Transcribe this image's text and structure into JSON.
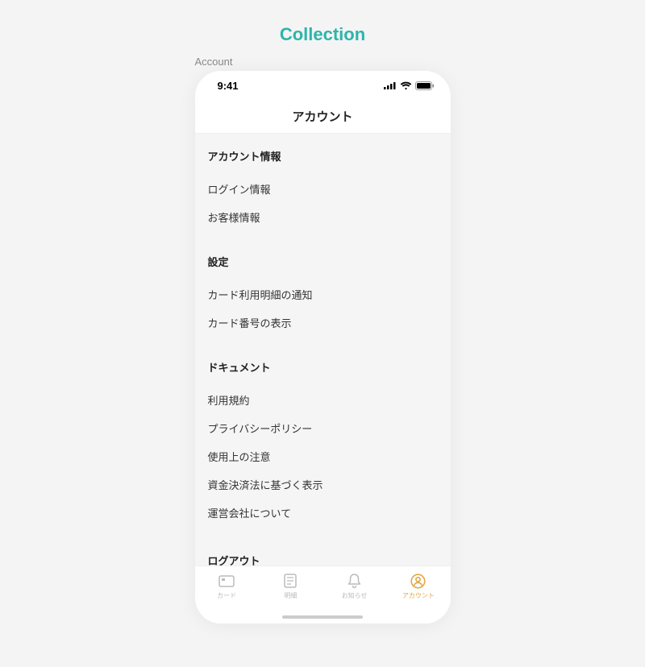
{
  "page": {
    "title": "Collection",
    "subtitle": "Account"
  },
  "statusBar": {
    "time": "9:41"
  },
  "header": {
    "title": "アカウント"
  },
  "sections": [
    {
      "title": "アカウント情報",
      "items": [
        "ログイン情報",
        "お客様情報"
      ]
    },
    {
      "title": "設定",
      "items": [
        "カード利用明細の通知",
        "カード番号の表示"
      ]
    },
    {
      "title": "ドキュメント",
      "items": [
        "利用規約",
        "プライバシーポリシー",
        "使用上の注意",
        "資金決済法に基づく表示",
        "運営会社について"
      ]
    }
  ],
  "logout": {
    "label": "ログアウト"
  },
  "tabs": [
    {
      "label": "カード",
      "icon": "card",
      "active": false
    },
    {
      "label": "明細",
      "icon": "list",
      "active": false
    },
    {
      "label": "お知らせ",
      "icon": "bell",
      "active": false
    },
    {
      "label": "アカウント",
      "icon": "user",
      "active": true
    }
  ]
}
